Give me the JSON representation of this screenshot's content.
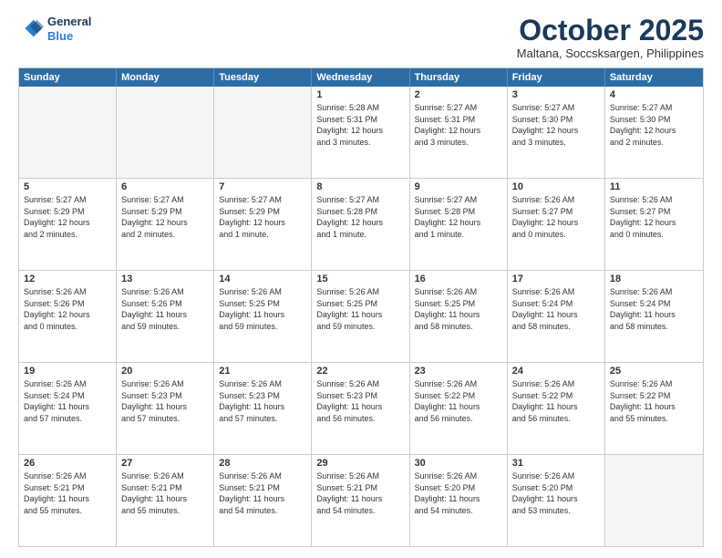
{
  "header": {
    "logo_line1": "General",
    "logo_line2": "Blue",
    "month": "October 2025",
    "location": "Maltana, Soccsksargen, Philippines"
  },
  "weekdays": [
    "Sunday",
    "Monday",
    "Tuesday",
    "Wednesday",
    "Thursday",
    "Friday",
    "Saturday"
  ],
  "rows": [
    [
      {
        "day": "",
        "lines": [],
        "empty": true
      },
      {
        "day": "",
        "lines": [],
        "empty": true
      },
      {
        "day": "",
        "lines": [],
        "empty": true
      },
      {
        "day": "1",
        "lines": [
          "Sunrise: 5:28 AM",
          "Sunset: 5:31 PM",
          "Daylight: 12 hours",
          "and 3 minutes."
        ]
      },
      {
        "day": "2",
        "lines": [
          "Sunrise: 5:27 AM",
          "Sunset: 5:31 PM",
          "Daylight: 12 hours",
          "and 3 minutes."
        ]
      },
      {
        "day": "3",
        "lines": [
          "Sunrise: 5:27 AM",
          "Sunset: 5:30 PM",
          "Daylight: 12 hours",
          "and 3 minutes."
        ]
      },
      {
        "day": "4",
        "lines": [
          "Sunrise: 5:27 AM",
          "Sunset: 5:30 PM",
          "Daylight: 12 hours",
          "and 2 minutes."
        ]
      }
    ],
    [
      {
        "day": "5",
        "lines": [
          "Sunrise: 5:27 AM",
          "Sunset: 5:29 PM",
          "Daylight: 12 hours",
          "and 2 minutes."
        ]
      },
      {
        "day": "6",
        "lines": [
          "Sunrise: 5:27 AM",
          "Sunset: 5:29 PM",
          "Daylight: 12 hours",
          "and 2 minutes."
        ]
      },
      {
        "day": "7",
        "lines": [
          "Sunrise: 5:27 AM",
          "Sunset: 5:29 PM",
          "Daylight: 12 hours",
          "and 1 minute."
        ]
      },
      {
        "day": "8",
        "lines": [
          "Sunrise: 5:27 AM",
          "Sunset: 5:28 PM",
          "Daylight: 12 hours",
          "and 1 minute."
        ]
      },
      {
        "day": "9",
        "lines": [
          "Sunrise: 5:27 AM",
          "Sunset: 5:28 PM",
          "Daylight: 12 hours",
          "and 1 minute."
        ]
      },
      {
        "day": "10",
        "lines": [
          "Sunrise: 5:26 AM",
          "Sunset: 5:27 PM",
          "Daylight: 12 hours",
          "and 0 minutes."
        ]
      },
      {
        "day": "11",
        "lines": [
          "Sunrise: 5:26 AM",
          "Sunset: 5:27 PM",
          "Daylight: 12 hours",
          "and 0 minutes."
        ]
      }
    ],
    [
      {
        "day": "12",
        "lines": [
          "Sunrise: 5:26 AM",
          "Sunset: 5:26 PM",
          "Daylight: 12 hours",
          "and 0 minutes."
        ]
      },
      {
        "day": "13",
        "lines": [
          "Sunrise: 5:26 AM",
          "Sunset: 5:26 PM",
          "Daylight: 11 hours",
          "and 59 minutes."
        ]
      },
      {
        "day": "14",
        "lines": [
          "Sunrise: 5:26 AM",
          "Sunset: 5:25 PM",
          "Daylight: 11 hours",
          "and 59 minutes."
        ]
      },
      {
        "day": "15",
        "lines": [
          "Sunrise: 5:26 AM",
          "Sunset: 5:25 PM",
          "Daylight: 11 hours",
          "and 59 minutes."
        ]
      },
      {
        "day": "16",
        "lines": [
          "Sunrise: 5:26 AM",
          "Sunset: 5:25 PM",
          "Daylight: 11 hours",
          "and 58 minutes."
        ]
      },
      {
        "day": "17",
        "lines": [
          "Sunrise: 5:26 AM",
          "Sunset: 5:24 PM",
          "Daylight: 11 hours",
          "and 58 minutes."
        ]
      },
      {
        "day": "18",
        "lines": [
          "Sunrise: 5:26 AM",
          "Sunset: 5:24 PM",
          "Daylight: 11 hours",
          "and 58 minutes."
        ]
      }
    ],
    [
      {
        "day": "19",
        "lines": [
          "Sunrise: 5:26 AM",
          "Sunset: 5:24 PM",
          "Daylight: 11 hours",
          "and 57 minutes."
        ]
      },
      {
        "day": "20",
        "lines": [
          "Sunrise: 5:26 AM",
          "Sunset: 5:23 PM",
          "Daylight: 11 hours",
          "and 57 minutes."
        ]
      },
      {
        "day": "21",
        "lines": [
          "Sunrise: 5:26 AM",
          "Sunset: 5:23 PM",
          "Daylight: 11 hours",
          "and 57 minutes."
        ]
      },
      {
        "day": "22",
        "lines": [
          "Sunrise: 5:26 AM",
          "Sunset: 5:23 PM",
          "Daylight: 11 hours",
          "and 56 minutes."
        ]
      },
      {
        "day": "23",
        "lines": [
          "Sunrise: 5:26 AM",
          "Sunset: 5:22 PM",
          "Daylight: 11 hours",
          "and 56 minutes."
        ]
      },
      {
        "day": "24",
        "lines": [
          "Sunrise: 5:26 AM",
          "Sunset: 5:22 PM",
          "Daylight: 11 hours",
          "and 56 minutes."
        ]
      },
      {
        "day": "25",
        "lines": [
          "Sunrise: 5:26 AM",
          "Sunset: 5:22 PM",
          "Daylight: 11 hours",
          "and 55 minutes."
        ]
      }
    ],
    [
      {
        "day": "26",
        "lines": [
          "Sunrise: 5:26 AM",
          "Sunset: 5:21 PM",
          "Daylight: 11 hours",
          "and 55 minutes."
        ]
      },
      {
        "day": "27",
        "lines": [
          "Sunrise: 5:26 AM",
          "Sunset: 5:21 PM",
          "Daylight: 11 hours",
          "and 55 minutes."
        ]
      },
      {
        "day": "28",
        "lines": [
          "Sunrise: 5:26 AM",
          "Sunset: 5:21 PM",
          "Daylight: 11 hours",
          "and 54 minutes."
        ]
      },
      {
        "day": "29",
        "lines": [
          "Sunrise: 5:26 AM",
          "Sunset: 5:21 PM",
          "Daylight: 11 hours",
          "and 54 minutes."
        ]
      },
      {
        "day": "30",
        "lines": [
          "Sunrise: 5:26 AM",
          "Sunset: 5:20 PM",
          "Daylight: 11 hours",
          "and 54 minutes."
        ]
      },
      {
        "day": "31",
        "lines": [
          "Sunrise: 5:26 AM",
          "Sunset: 5:20 PM",
          "Daylight: 11 hours",
          "and 53 minutes."
        ]
      },
      {
        "day": "",
        "lines": [],
        "empty": true
      }
    ]
  ]
}
